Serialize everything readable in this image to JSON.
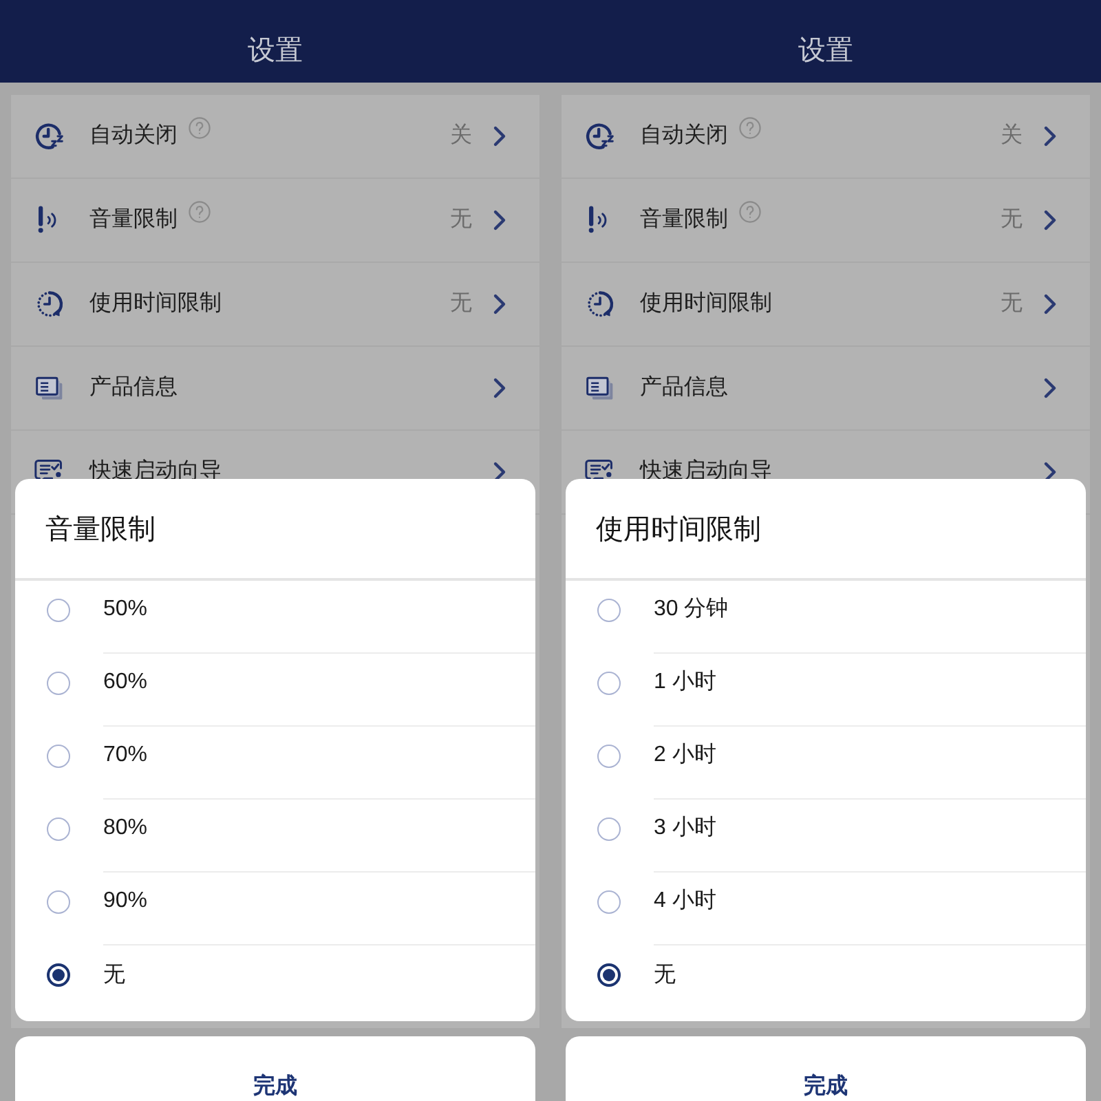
{
  "screens": [
    {
      "header": {
        "title": "设置"
      },
      "settings": [
        {
          "label": "自动关闭",
          "help": true,
          "value": "关"
        },
        {
          "label": "音量限制",
          "help": true,
          "value": "无"
        },
        {
          "label": "使用时间限制",
          "help": false,
          "value": "无"
        },
        {
          "label": "产品信息",
          "help": false
        },
        {
          "label": "快速启动向导",
          "help": false
        }
      ],
      "sheet": {
        "title": "音量限制",
        "options": [
          {
            "label": "50%",
            "selected": false
          },
          {
            "label": "60%",
            "selected": false
          },
          {
            "label": "70%",
            "selected": false
          },
          {
            "label": "80%",
            "selected": false
          },
          {
            "label": "90%",
            "selected": false
          },
          {
            "label": "无",
            "selected": true
          }
        ]
      },
      "done_button": {
        "label": "完成"
      }
    },
    {
      "header": {
        "title": "设置"
      },
      "settings": [
        {
          "label": "自动关闭",
          "help": true,
          "value": "关"
        },
        {
          "label": "音量限制",
          "help": true,
          "value": "无"
        },
        {
          "label": "使用时间限制",
          "help": false,
          "value": "无"
        },
        {
          "label": "产品信息",
          "help": false
        },
        {
          "label": "快速启动向导",
          "help": false
        }
      ],
      "sheet": {
        "title": "使用时间限制",
        "options": [
          {
            "label": "30 分钟",
            "selected": false
          },
          {
            "label": "1 小时",
            "selected": false
          },
          {
            "label": "2 小时",
            "selected": false
          },
          {
            "label": "3 小时",
            "selected": false
          },
          {
            "label": "4 小时",
            "selected": false
          },
          {
            "label": "无",
            "selected": true
          }
        ]
      },
      "done_button": {
        "label": "完成"
      }
    }
  ]
}
